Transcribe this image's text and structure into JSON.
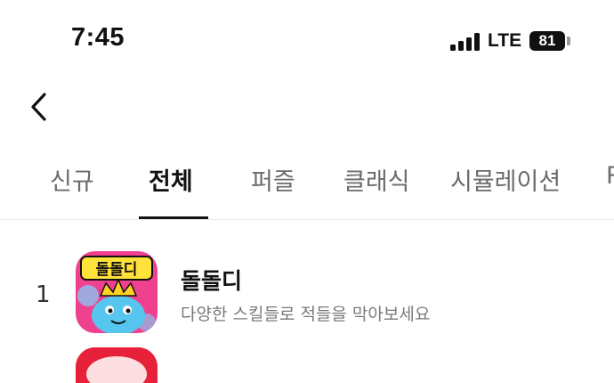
{
  "status_bar": {
    "time": "7:45",
    "network": "LTE",
    "battery": "81",
    "signal_icon": "signal-bars-icon"
  },
  "header": {
    "back_icon": "chevron-left-icon"
  },
  "tabs": [
    {
      "label": "신규",
      "active": false
    },
    {
      "label": "전체",
      "active": true
    },
    {
      "label": "퍼즐",
      "active": false
    },
    {
      "label": "클래식",
      "active": false
    },
    {
      "label": "시뮬레이션",
      "active": false
    },
    {
      "label": "R",
      "active": false
    }
  ],
  "apps": [
    {
      "rank": "1",
      "name": "돌돌디",
      "description": "다양한 스킬들로 적들을 막아보세요",
      "icon_text": "돌돌디"
    }
  ],
  "colors": {
    "active_tab": "#111111",
    "inactive_tab": "#6b6b6b",
    "icon_bg": "#f0418f",
    "icon_character": "#57c6ee",
    "next_icon_bg": "#e8213a"
  }
}
